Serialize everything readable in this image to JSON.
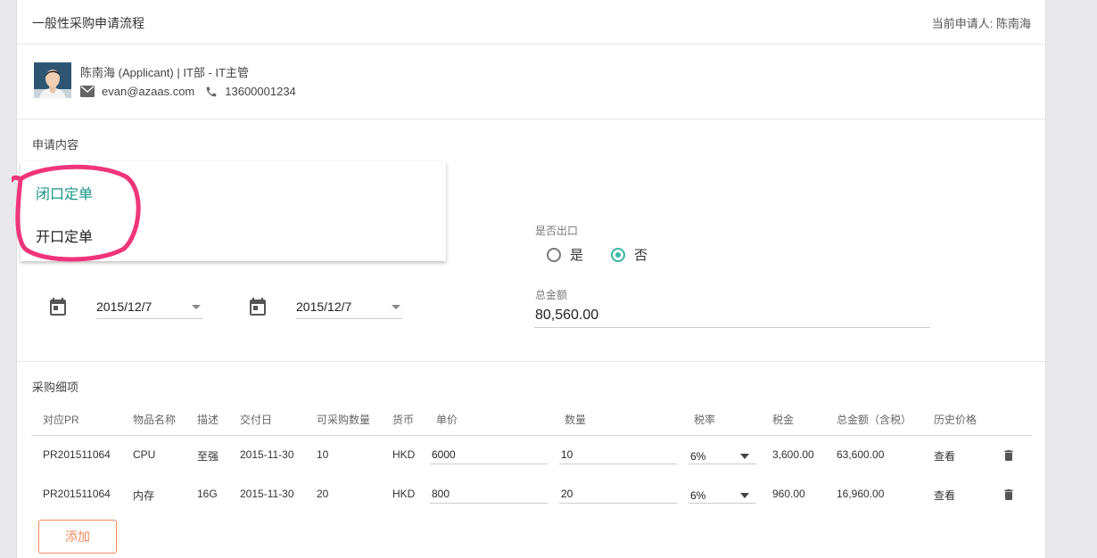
{
  "header": {
    "title": "一般性采购申请流程",
    "current_applicant": "当前申请人: 陈南海"
  },
  "applicant": {
    "line1": "陈南海  (Applicant)  |  IT部 - IT主管",
    "email": "evan@azaas.com",
    "phone": "13600001234"
  },
  "application": {
    "section_title": "申请内容",
    "order_type_options": [
      "闭口定单",
      "开口定单"
    ],
    "order_type_selected_index": 0,
    "export_label": "是否出口",
    "export_options": [
      "是",
      "否"
    ],
    "export_selected": "否",
    "start_date": "2015/12/7",
    "end_date": "2015/12/7",
    "total_label": "总金额",
    "total_value": "80,560.00"
  },
  "details": {
    "section_title": "采购细项",
    "columns": [
      "对应PR",
      "物品名称",
      "描述",
      "交付日",
      "可采购数量",
      "货币",
      "单价",
      "数量",
      "税率",
      "税金",
      "总金额（含税）",
      "历史价格"
    ],
    "rows": [
      {
        "pr": "PR201511064",
        "item": "CPU",
        "desc": "至强",
        "delivery": "2015-11-30",
        "available_qty": "10",
        "currency": "HKD",
        "unit_price": "6000",
        "qty": "10",
        "tax_rate": "6%",
        "tax": "3,600.00",
        "total": "63,600.00",
        "history": "查看"
      },
      {
        "pr": "PR201511064",
        "item": "内存",
        "desc": "16G",
        "delivery": "2015-11-30",
        "available_qty": "20",
        "currency": "HKD",
        "unit_price": "800",
        "qty": "20",
        "tax_rate": "6%",
        "tax": "960.00",
        "total": "16,960.00",
        "history": "查看"
      }
    ],
    "add_label": "添加"
  },
  "colors": {
    "accent_teal": "#199485",
    "radio_teal": "#37b5a4",
    "add_orange": "#f08a5d",
    "annotation_pink": "#f0357a"
  }
}
